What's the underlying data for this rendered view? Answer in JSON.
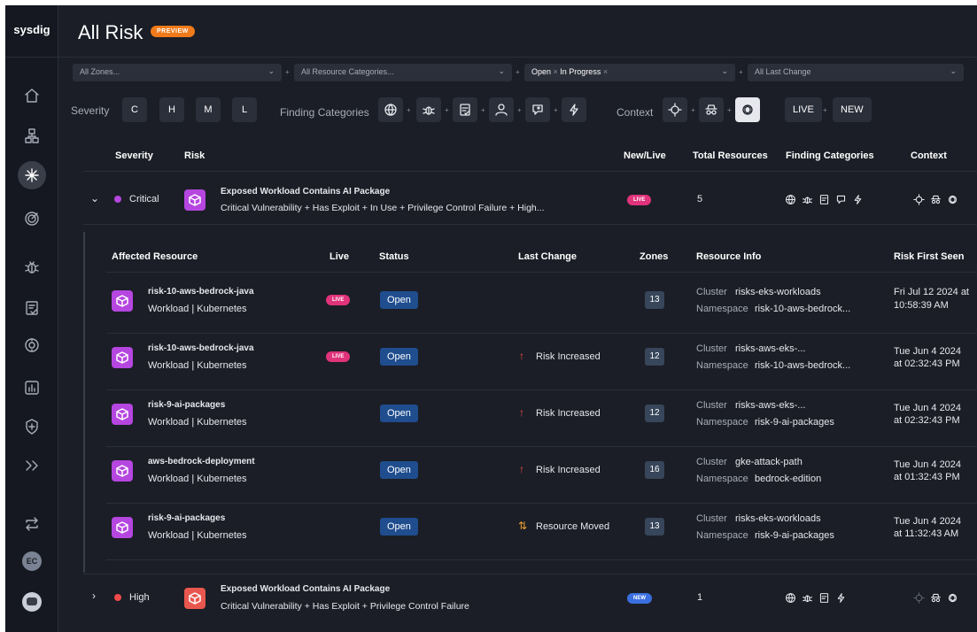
{
  "brand": "sysdig",
  "page": {
    "title": "All Risk",
    "badge": "PREVIEW"
  },
  "filters": {
    "zones": "All Zones...",
    "resource_categories": "All Resource Categories...",
    "status_selected": [
      "Open",
      "In Progress"
    ],
    "last_change": "All Last Change"
  },
  "quick_filters": {
    "severity_label": "Severity",
    "severity_buttons": [
      "C",
      "H",
      "M",
      "L"
    ],
    "finding_categories_label": "Finding Categories",
    "context_label": "Context",
    "live_label": "LIVE",
    "new_label": "NEW"
  },
  "table": {
    "headers": [
      "Severity",
      "Risk",
      "New/Live",
      "Total Resources",
      "Finding Categories",
      "Context"
    ],
    "rows": [
      {
        "severity": "Critical",
        "severity_color": "#b546e0",
        "icon_color": "#b546e0",
        "title": "Exposed Workload Contains AI Package",
        "subtitle": "Critical Vulnerability + Has Exploit + In Use + Privilege Control Failure + High...",
        "badge": "LIVE",
        "total": "5"
      },
      {
        "severity": "High",
        "severity_color": "#f04a4a",
        "icon_color": "#e8574e",
        "title": "Exposed Workload Contains AI Package",
        "subtitle": "Critical Vulnerability + Has Exploit + Privilege Control Failure",
        "badge": "NEW",
        "total": "1"
      }
    ]
  },
  "affected": {
    "headers": [
      "Affected Resource",
      "Live",
      "Status",
      "Last Change",
      "Zones",
      "Resource Info",
      "Risk First Seen"
    ],
    "cluster_label": "Cluster",
    "namespace_label": "Namespace",
    "rows": [
      {
        "name": "risk-10-aws-bedrock-java",
        "type": "Workload | Kubernetes",
        "live": "LIVE",
        "status": "Open",
        "change": "",
        "zones": "13",
        "cluster": "risks-eks-workloads",
        "namespace": "risk-10-aws-bedrock...",
        "seen1": "Fri Jul 12 2024 at",
        "seen2": "10:58:39 AM"
      },
      {
        "name": "risk-10-aws-bedrock-java",
        "type": "Workload | Kubernetes",
        "live": "LIVE",
        "status": "Open",
        "change": "Risk Increased",
        "zones": "12",
        "cluster": "risks-aws-eks-...",
        "namespace": "risk-10-aws-bedrock...",
        "seen1": "Tue Jun 4 2024",
        "seen2": "at 02:32:43 PM"
      },
      {
        "name": "risk-9-ai-packages",
        "type": "Workload | Kubernetes",
        "live": "",
        "status": "Open",
        "change": "Risk Increased",
        "zones": "12",
        "cluster": "risks-aws-eks-...",
        "namespace": "risk-9-ai-packages",
        "seen1": "Tue Jun 4 2024",
        "seen2": "at 02:32:43 PM"
      },
      {
        "name": "aws-bedrock-deployment",
        "type": "Workload | Kubernetes",
        "live": "",
        "status": "Open",
        "change": "Risk Increased",
        "zones": "16",
        "cluster": "gke-attack-path",
        "namespace": "bedrock-edition",
        "seen1": "Tue Jun 4 2024",
        "seen2": "at 01:32:43 PM"
      },
      {
        "name": "risk-9-ai-packages",
        "type": "Workload | Kubernetes",
        "live": "",
        "status": "Open",
        "change": "Resource Moved",
        "zones": "13",
        "cluster": "risks-eks-workloads",
        "namespace": "risk-9-ai-packages",
        "seen1": "Tue Jun 4 2024",
        "seen2": "at 11:32:43 AM"
      }
    ]
  },
  "sidebar": {
    "icons": [
      "home-icon",
      "inventory-icon",
      "risk-icon",
      "posture-icon",
      "threats-icon",
      "compliance-icon",
      "vulnerabilities-icon",
      "reports-icon",
      "policies-icon",
      "expand-icon",
      "integrations-icon"
    ],
    "avatar": "EC"
  }
}
